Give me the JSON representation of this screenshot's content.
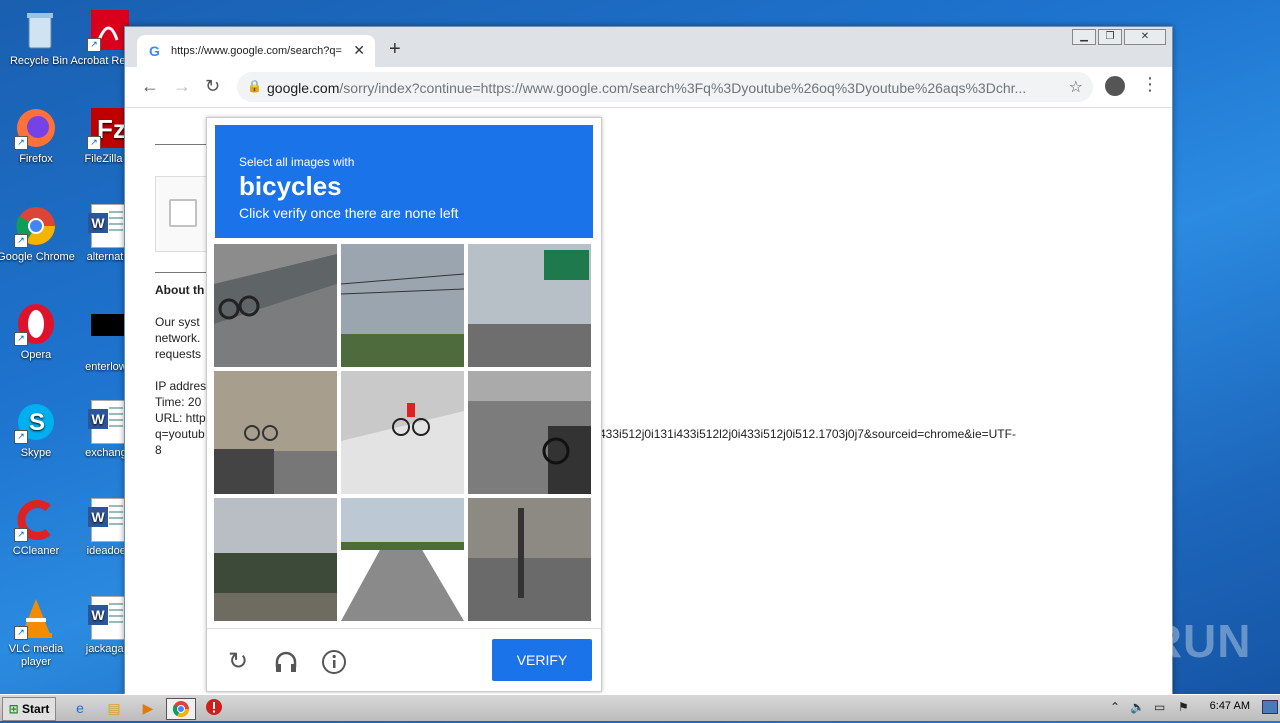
{
  "desktop": {
    "icons_col1": [
      "Recycle Bin",
      "Firefox",
      "Google Chrome",
      "Opera",
      "Skype",
      "CCleaner",
      "VLC media player"
    ],
    "icons_col2": [
      "Acrobat Reader",
      "FileZilla C",
      "alternativ",
      "enterlowe",
      "exchange",
      "ideadoes",
      "jackagain"
    ]
  },
  "browser": {
    "tab_title": "https://www.google.com/search?q=",
    "url_domain": "google.com",
    "url_rest": "/sorry/index?continue=https://www.google.com/search%3Fq%3Dyoutube%26oq%3Dyoutube%26aqs%3Dchr..."
  },
  "page": {
    "about_heading": "About th",
    "para1": [
      "Our syst",
      "network.",
      "requests"
    ],
    "info_lines": [
      "IP addres",
      "Time: 20",
      "URL: http",
      "q=youtub"
    ],
    "url_tail": "433i512j0i131i433i512l2j0i433i512j0i512.1703j0j7&sourceid=chrome&ie=UTF-",
    "url_end": "8"
  },
  "captcha": {
    "instruction": "Select all images with",
    "target": "bicycles",
    "hint": "Click verify once there are none left",
    "verify_label": "VERIFY",
    "reload_icon": "reload-icon",
    "audio_icon": "headphones-icon",
    "info_icon": "info-icon"
  },
  "watermark": "ANY.RUN",
  "taskbar": {
    "start_label": "Start",
    "time": "6:47 AM"
  }
}
